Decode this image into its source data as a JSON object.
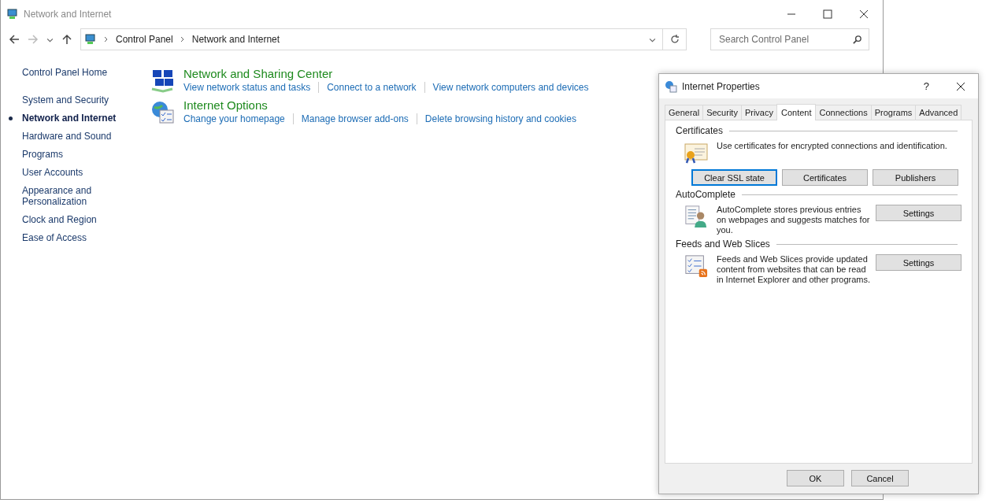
{
  "window": {
    "title": "Network and Internet"
  },
  "nav": {
    "breadcrumb": [
      "Control Panel",
      "Network and Internet"
    ],
    "search": {
      "placeholder": "Search Control Panel"
    }
  },
  "sidebar": {
    "home": "Control Panel Home",
    "items": [
      {
        "label": "System and Security",
        "selected": false
      },
      {
        "label": "Network and Internet",
        "selected": true
      },
      {
        "label": "Hardware and Sound",
        "selected": false
      },
      {
        "label": "Programs",
        "selected": false
      },
      {
        "label": "User Accounts",
        "selected": false
      },
      {
        "label": "Appearance and Personalization",
        "selected": false
      },
      {
        "label": "Clock and Region",
        "selected": false
      },
      {
        "label": "Ease of Access",
        "selected": false
      }
    ]
  },
  "categories": [
    {
      "title": "Network and Sharing Center",
      "links": [
        "View network status and tasks",
        "Connect to a network",
        "View network computers and devices"
      ]
    },
    {
      "title": "Internet Options",
      "links": [
        "Change your homepage",
        "Manage browser add-ons",
        "Delete browsing history and cookies"
      ]
    }
  ],
  "dialog": {
    "title": "Internet Properties",
    "help": "?",
    "tabs": [
      {
        "label": "General",
        "selected": false
      },
      {
        "label": "Security",
        "selected": false
      },
      {
        "label": "Privacy",
        "selected": false
      },
      {
        "label": "Content",
        "selected": true
      },
      {
        "label": "Connections",
        "selected": false
      },
      {
        "label": "Programs",
        "selected": false
      },
      {
        "label": "Advanced",
        "selected": false
      }
    ],
    "sections": [
      {
        "heading": "Certificates",
        "kind": "stacked",
        "text": "Use certificates for encrypted connections and identification.",
        "buttons": [
          {
            "label": "Clear SSL state",
            "focused": true
          },
          {
            "label": "Certificates",
            "focused": false
          },
          {
            "label": "Publishers",
            "focused": false
          }
        ]
      },
      {
        "heading": "AutoComplete",
        "kind": "side",
        "text": "AutoComplete stores previous entries on webpages and suggests matches for you.",
        "buttons": [
          {
            "label": "Settings",
            "focused": false
          }
        ]
      },
      {
        "heading": "Feeds and Web Slices",
        "kind": "side",
        "text": "Feeds and Web Slices provide updated content from websites that can be read in Internet Explorer and other programs.",
        "buttons": [
          {
            "label": "Settings",
            "focused": false
          }
        ]
      }
    ],
    "buttons": [
      "OK",
      "Cancel"
    ]
  }
}
